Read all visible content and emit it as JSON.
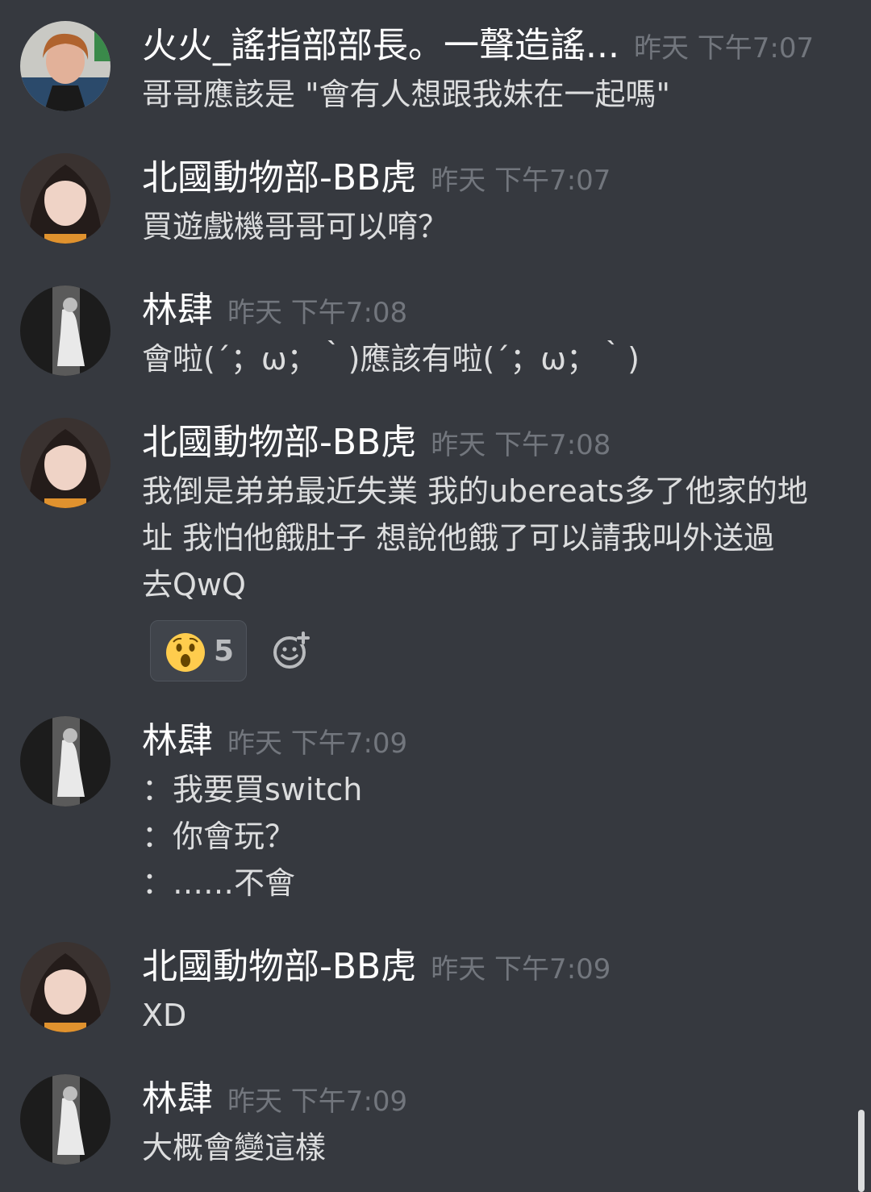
{
  "colors": {
    "background": "#36393f",
    "username": "#ffffff",
    "timestamp": "#72767d",
    "message_text": "#dcddde",
    "reaction_bg": "#40444b"
  },
  "messages": [
    {
      "author": "火火_謠指部部長。一聲造謠...",
      "time": "昨天 下午7:07",
      "avatar_icon": "user-avatar-icon",
      "lines": [
        "哥哥應該是 \"會有人想跟我妹在一起嗎\""
      ]
    },
    {
      "author": "北國動物部-BB虎",
      "time": "昨天 下午7:07",
      "avatar_icon": "user-avatar-icon",
      "lines": [
        "買遊戲機哥哥可以唷？"
      ]
    },
    {
      "author": "林肆",
      "time": "昨天 下午7:08",
      "avatar_icon": "user-avatar-icon",
      "lines": [
        "會啦(´；ω；｀)應該有啦(´；ω；｀)"
      ]
    },
    {
      "author": "北國動物部-BB虎",
      "time": "昨天 下午7:08",
      "avatar_icon": "user-avatar-icon",
      "lines": [
        "我倒是弟弟最近失業 我的ubereats多了他家的地",
        "址 我怕他餓肚子 想說他餓了可以請我叫外送過",
        "去QwQ"
      ],
      "reaction": {
        "emoji_icon": "astonished-face-icon",
        "count": "5"
      },
      "add_reaction_icon": "add-reaction-icon"
    },
    {
      "author": "林肆",
      "time": "昨天 下午7:09",
      "avatar_icon": "user-avatar-icon",
      "lines": [
        "：我要買switch",
        "：你會玩？",
        "：……不會"
      ]
    },
    {
      "author": "北國動物部-BB虎",
      "time": "昨天 下午7:09",
      "avatar_icon": "user-avatar-icon",
      "lines": [
        "XD"
      ]
    },
    {
      "author": "林肆",
      "time": "昨天 下午7:09",
      "avatar_icon": "user-avatar-icon",
      "lines": [
        "大概會變這樣"
      ]
    }
  ]
}
